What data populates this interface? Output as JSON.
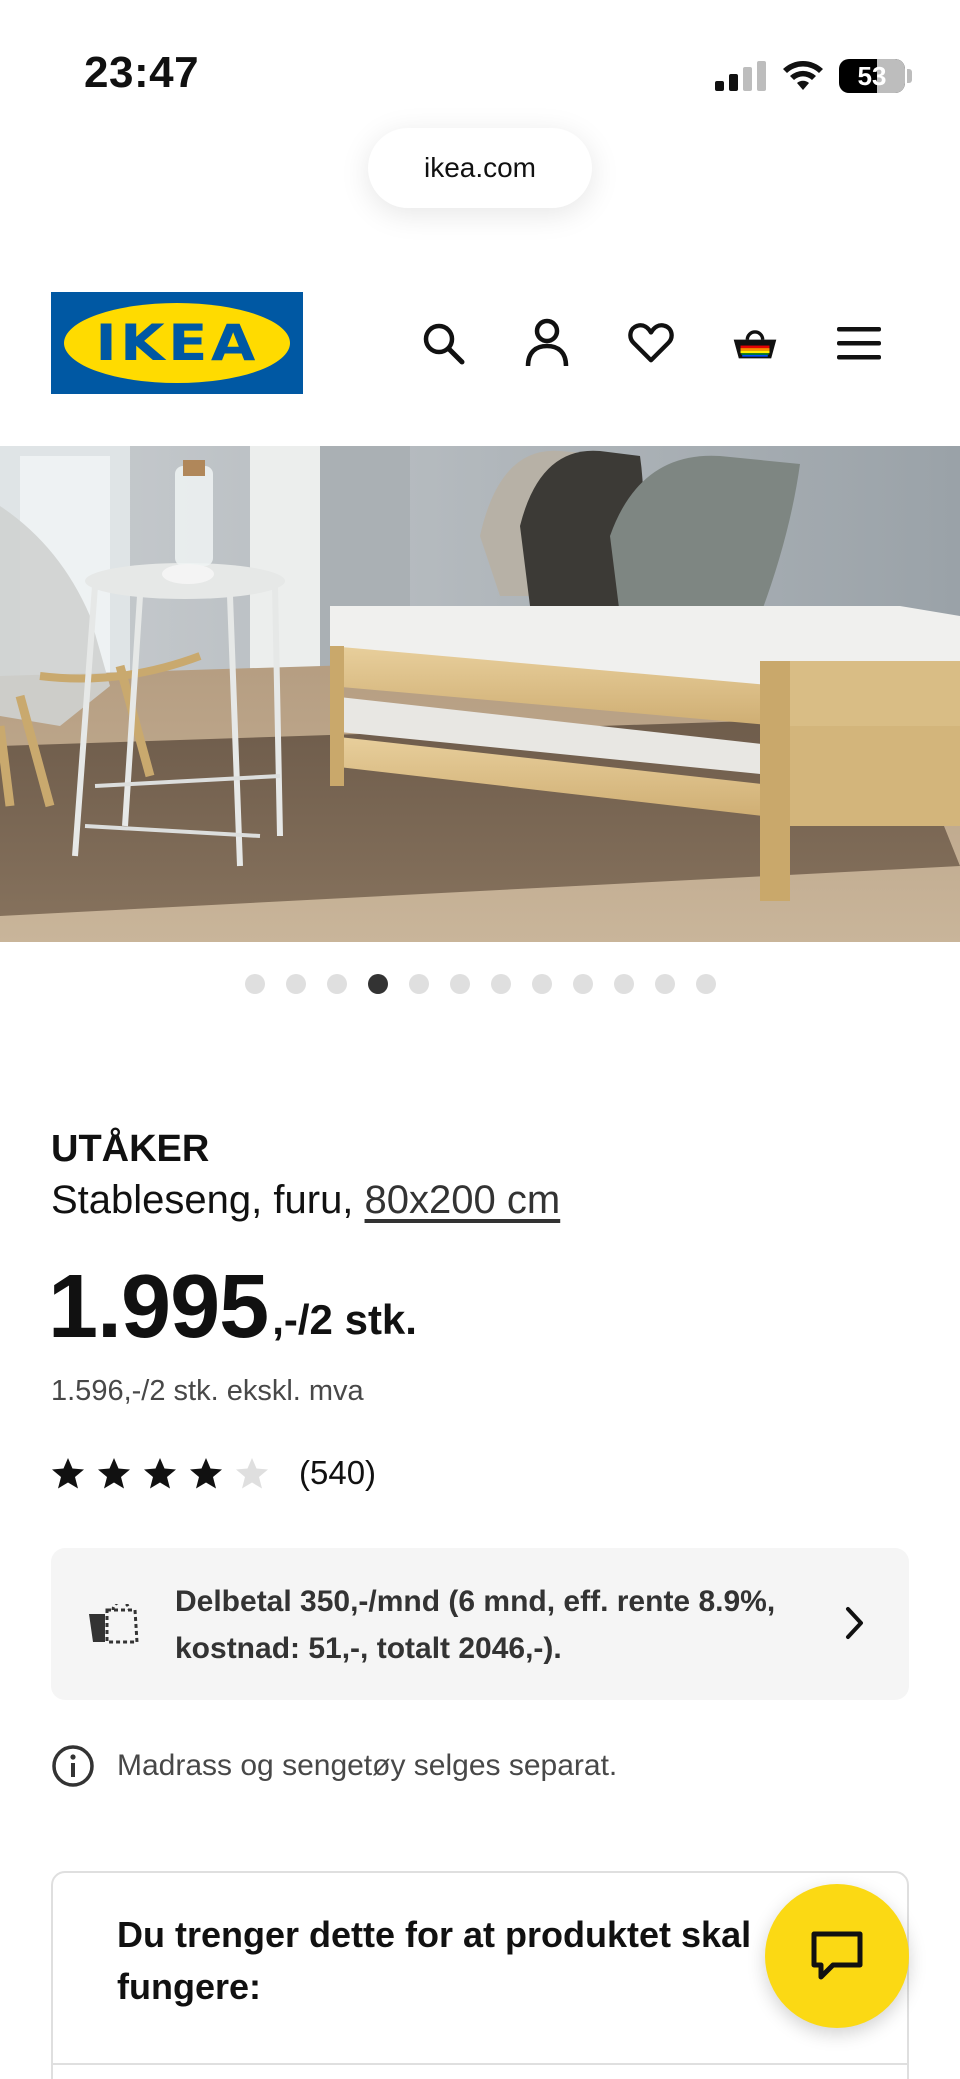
{
  "status_bar": {
    "time": "23:47",
    "battery": "53"
  },
  "browser": {
    "url": "ikea.com"
  },
  "header": {
    "logo_text": "IKEA",
    "icons": [
      "search-icon",
      "account-icon",
      "heart-icon",
      "basket-icon",
      "menu-icon"
    ]
  },
  "gallery": {
    "total_images": 12,
    "active_index": 3
  },
  "product": {
    "name": "UTÅKER",
    "description": "Stableseng, furu, ",
    "size_link": "80x200 cm",
    "price_main": "1.995",
    "price_suffix": ",-/2 stk.",
    "price_ex_vat": "1.596,-/2 stk. ekskl. mva",
    "rating_value": 4,
    "rating_max": 5,
    "rating_count": "(540)"
  },
  "payment": {
    "text": "Delbetal 350,-/mnd (6 mnd, eff. rente 8.9%, kostnad: 51,-, totalt 2046,-)."
  },
  "notice": {
    "text": "Madrass og sengetøy selges separat."
  },
  "needs": {
    "title": "Du trenger dette for at produktet skal fungere:"
  },
  "colors": {
    "ikea_blue": "#0058a3",
    "ikea_yellow": "#ffdb00",
    "chat_yellow": "#fbd914"
  }
}
